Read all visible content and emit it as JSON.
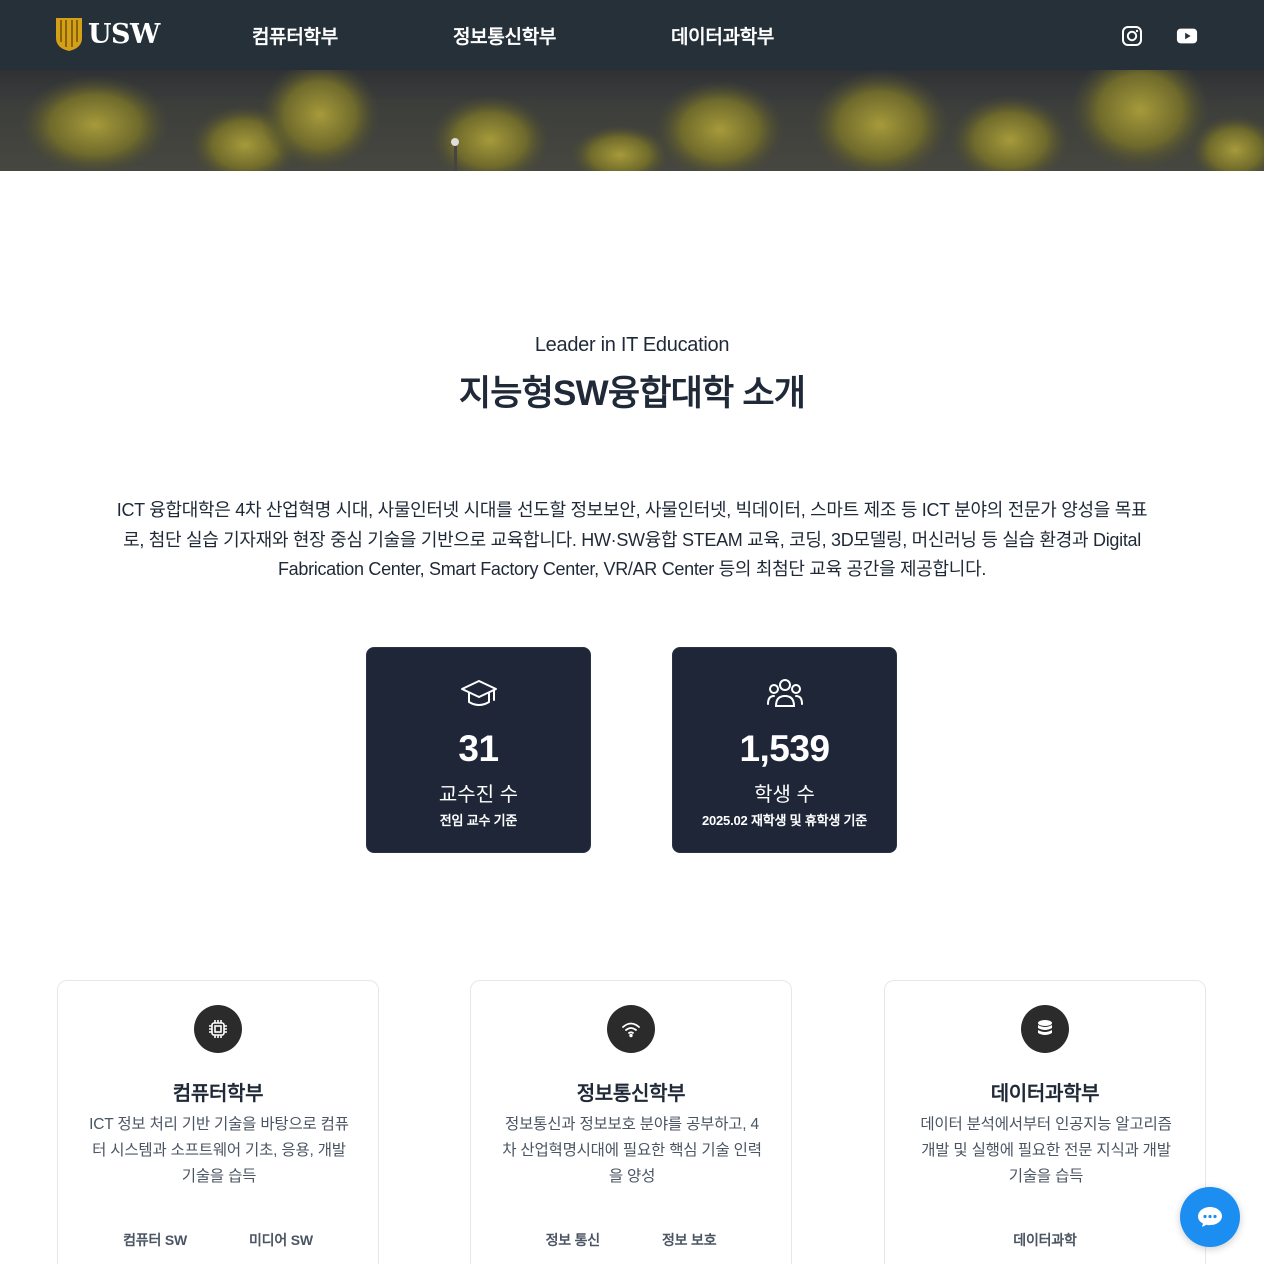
{
  "brand": {
    "logo_text": "USW"
  },
  "nav": {
    "links": [
      "컴퓨터학부",
      "정보통신학부",
      "데이터과학부"
    ],
    "social": [
      "instagram-icon",
      "youtube-icon"
    ]
  },
  "intro": {
    "eyebrow": "Leader in IT Education",
    "title": "지능형SW융합대학 소개",
    "description": "ICT 융합대학은 4차 산업혁명 시대, 사물인터넷 시대를 선도할 정보보안, 사물인터넷, 빅데이터, 스마트 제조 등 ICT 분야의 전문가 양성을 목표로, 첨단 실습 기자재와 현장 중심 기술을 기반으로 교육합니다. HW·SW융합 STEAM 교육, 코딩, 3D모델링, 머신러닝 등 실습 환경과 Digital Fabrication Center, Smart Factory Center, VR/AR Center 등의 최첨단 교육 공간을 제공합니다."
  },
  "stats": [
    {
      "icon": "graduation-cap-icon",
      "value": "31",
      "label": "교수진 수",
      "sub": "전임 교수 기준"
    },
    {
      "icon": "users-icon",
      "value": "1,539",
      "label": "학생 수",
      "sub": "2025.02 재학생 및 휴학생 기준"
    }
  ],
  "departments": [
    {
      "icon": "cpu-chip-icon",
      "title": "컴퓨터학부",
      "description": "ICT 정보 처리 기반 기술을 바탕으로 컴퓨터 시스템과 소프트웨어 기초, 응용, 개발 기술을 습득",
      "tags": [
        "컴퓨터 SW",
        "미디어 SW"
      ]
    },
    {
      "icon": "wifi-icon",
      "title": "정보통신학부",
      "description": "정보통신과 정보보호 분야를 공부하고, 4차 산업혁명시대에 필요한 핵심 기술 인력을 양성",
      "tags": [
        "정보 통신",
        "정보 보호"
      ]
    },
    {
      "icon": "database-icon",
      "title": "데이터과학부",
      "description": "데이터 분석에서부터 인공지능 알고리즘 개발 및 실행에 필요한 전문 지식과 개발 기술을 습득",
      "tags": [
        "데이터과학"
      ]
    }
  ],
  "chat": {
    "icon": "chat-bubble-icon"
  },
  "colors": {
    "nav_bg": "#253039",
    "stat_card_bg": "#1e2638",
    "chat_button": "#1c8ef2",
    "logo_gold": "#d4a017"
  }
}
